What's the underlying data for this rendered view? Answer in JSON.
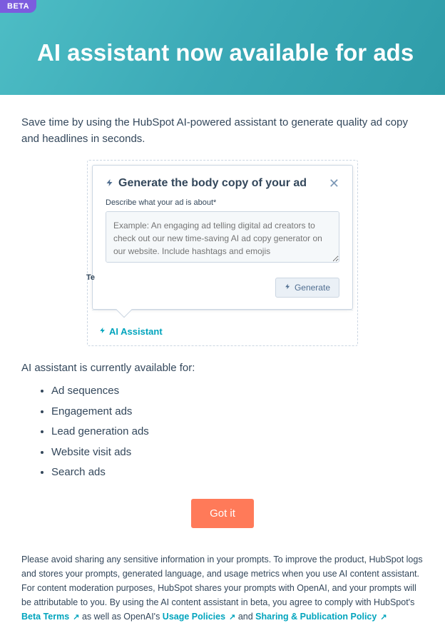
{
  "badge": "BETA",
  "title": "AI assistant now available for ads",
  "intro": "Save time by using the HubSpot AI-powered assistant to generate quality ad copy and headlines in seconds.",
  "popover": {
    "title": "Generate the body copy of your ad",
    "field_label": "Describe what your ad is about*",
    "placeholder": "Example: An engaging ad telling digital ad creators to check out our new time-saving AI ad copy generator on our website. Include hashtags and emojis",
    "generate_label": "Generate",
    "ai_link": "AI Assistant",
    "left_cut_label": "Te"
  },
  "available_heading": "AI assistant is currently available for:",
  "bullets": [
    "Ad sequences",
    "Engagement ads",
    "Lead generation ads",
    "Website visit ads",
    "Search ads"
  ],
  "cta": "Got it",
  "legal": {
    "p1": "Please avoid sharing any sensitive information in your prompts. To improve the product, HubSpot logs and stores your prompts, generated language, and usage metrics when you use AI content assistant. For content moderation purposes, HubSpot shares your prompts with OpenAI, and your prompts will be attributable to you. By using the AI content assistant in beta, you agree to comply with HubSpot's ",
    "beta_terms": "Beta Terms",
    "p2": " as well as OpenAI's ",
    "usage_policies": "Usage Policies",
    "p3": " and ",
    "sharing_policy": "Sharing & Publication Policy"
  }
}
